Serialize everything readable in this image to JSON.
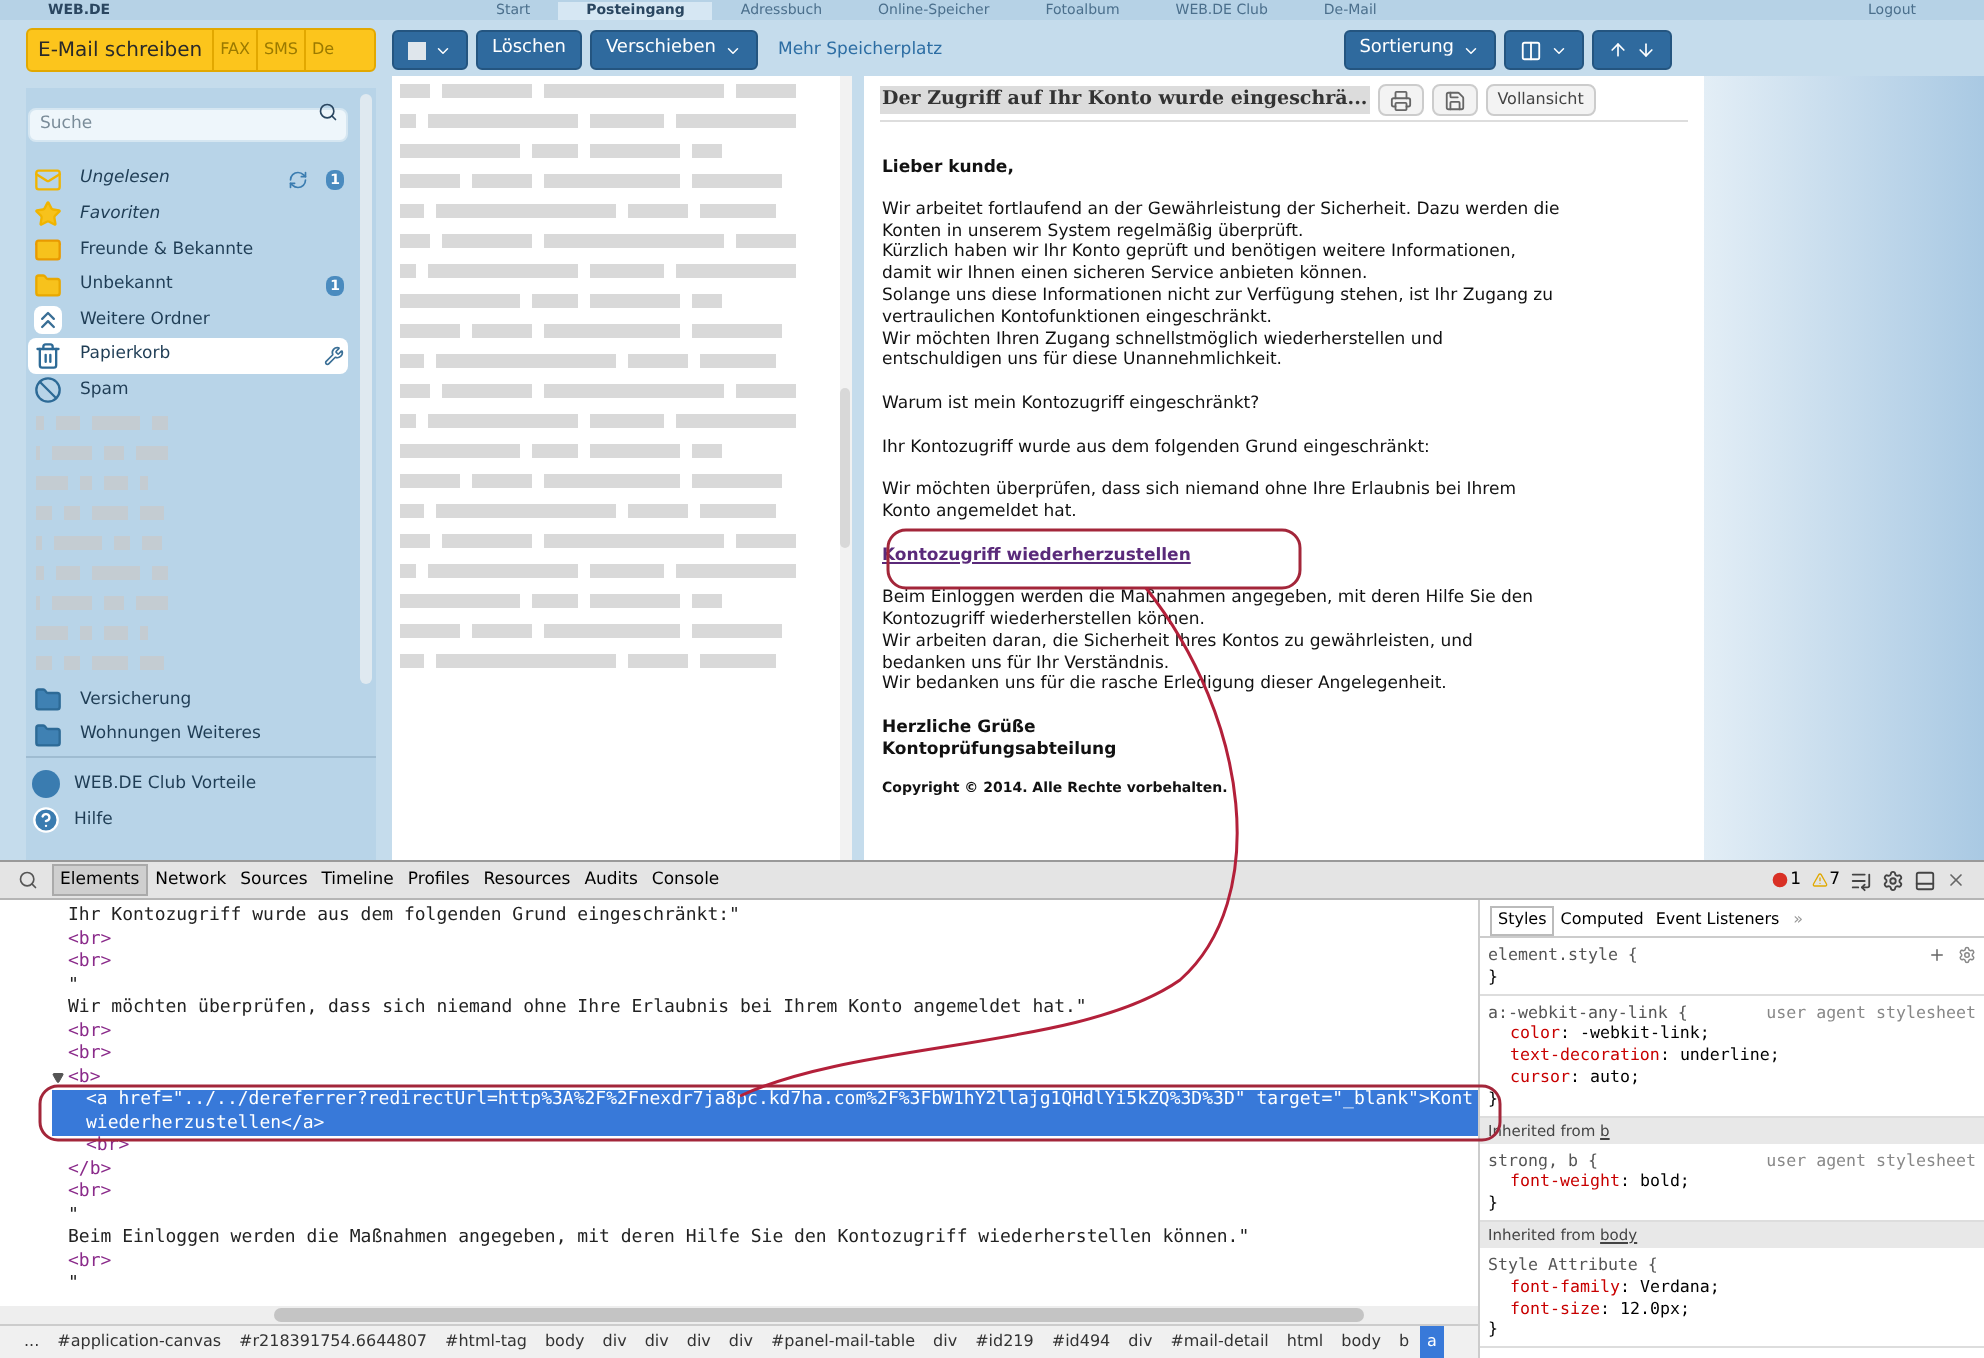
{
  "top_nav": {
    "logo": "WEB.DE",
    "tabs": [
      {
        "label": "Start",
        "selected": false
      },
      {
        "label": "Posteingang",
        "selected": true
      },
      {
        "label": "Adressbuch",
        "selected": false
      },
      {
        "label": "Online-Speicher",
        "selected": false
      },
      {
        "label": "Fotoalbum",
        "selected": false
      },
      {
        "label": "WEB.DE Club",
        "selected": false
      },
      {
        "label": "De-Mail",
        "selected": false
      }
    ],
    "logout": "Logout"
  },
  "compose": {
    "label": "E-Mail schreiben",
    "extras": [
      "FAX",
      "SMS",
      "De"
    ]
  },
  "sidebar": {
    "search": {
      "placeholder": "Suche"
    },
    "folders": [
      {
        "kind": "unread",
        "label": "Ungelesen",
        "italic": true,
        "count": "1",
        "selected": false
      },
      {
        "kind": "favorites",
        "label": "Favoriten",
        "italic": true,
        "selected": false
      },
      {
        "kind": "friends",
        "label": "Freunde & Bekannte",
        "italic": false,
        "selected": false
      },
      {
        "kind": "unknown",
        "label": "Unbekannt",
        "italic": false,
        "count": "1",
        "selected": false
      },
      {
        "kind": "more",
        "label": "Weitere Ordner",
        "italic": false,
        "selected": false
      },
      {
        "kind": "trash",
        "label": "Papierkorb",
        "italic": false,
        "selected": true
      },
      {
        "kind": "spam",
        "label": "Spam",
        "italic": false,
        "selected": false
      }
    ],
    "more_folders": [
      {
        "kind": "folder",
        "label": "Versicherung",
        "italic": false,
        "selected": false
      },
      {
        "kind": "folder",
        "label": "Wohnungen Weiteres",
        "italic": false,
        "selected": false
      }
    ],
    "links": [
      {
        "kind": "club",
        "label": "WEB.DE Club Vorteile"
      },
      {
        "kind": "help",
        "label": "Hilfe"
      }
    ]
  },
  "toolbar": {
    "delete": "Löschen",
    "move": "Verschieben",
    "more_storage": "Mehr Speicherplatz",
    "sort": "Sortierung"
  },
  "mail": {
    "subject": "Der Zugriff auf Ihr Konto wurde eingeschrä...",
    "full_view": "Vollansicht",
    "greeting": "Lieber kunde,",
    "paragraphs": [
      "Wir arbeitet fortlaufend an der Gewährleistung der Sicherheit. Dazu werden die\nKonten in unserem System regelmäßig überprüft.\nKürzlich haben wir Ihr Konto geprüft und benötigen weitere Informationen,\ndamit wir Ihnen einen sicheren Service anbieten können.\nSolange uns diese Informationen nicht zur Verfügung stehen, ist Ihr Zugang zu\nvertraulichen Kontofunktionen eingeschränkt.\nWir möchten Ihren Zugang schnellstmöglich wiederherstellen und\nentschuldigen uns für diese Unannehmlichkeit.",
      "Warum ist mein Kontozugriff eingeschränkt?",
      "Ihr Kontozugriff wurde aus dem folgenden Grund eingeschränkt:",
      "Wir möchten überprüfen, dass sich niemand ohne Ihre Erlaubnis bei Ihrem\nKonto angemeldet hat."
    ],
    "link": "Kontozugriff wiederherzustellen",
    "after": "Beim Einloggen werden die Maßnahmen angegeben, mit deren Hilfe Sie den\nKontozugriff wiederherstellen können.\nWir arbeiten daran, die Sicherheit Ihres Kontos zu gewährleisten, und\nbedanken uns für Ihr Verständnis.\nWir bedanken uns für die rasche Erledigung dieser Angelegenheit.",
    "signature": "Herzliche Grüße\nKontoprüfungsabteilung",
    "copyright": "Copyright © 2014. Alle Rechte vorbehalten."
  },
  "devtools": {
    "tabs": [
      {
        "label": "Elements",
        "selected": true
      },
      {
        "label": "Network",
        "selected": false
      },
      {
        "label": "Sources",
        "selected": false
      },
      {
        "label": "Timeline",
        "selected": false
      },
      {
        "label": "Profiles",
        "selected": false
      },
      {
        "label": "Resources",
        "selected": false
      },
      {
        "label": "Audits",
        "selected": false
      },
      {
        "label": "Console",
        "selected": false
      }
    ],
    "errors": "1",
    "warnings": "7",
    "dom_tree": [
      {
        "text": "Ihr Kontozugriff wurde aus dem folgenden Grund eingeschränkt:\""
      },
      {
        "text": "<br>"
      },
      {
        "text": "<br>"
      },
      {
        "text": "\""
      },
      {
        "text": "Wir möchten überprüfen, dass sich niemand ohne Ihre Erlaubnis bei Ihrem Konto angemeldet hat.\""
      },
      {
        "text": "<br>"
      },
      {
        "text": "<br>"
      },
      {
        "text": "<b>",
        "expanded": true,
        "closing": "</b>",
        "children": [
          {
            "text": "<a href=\"../../dereferrer?redirectUrl=http%3A%2F%2Fnexdr7ja8pc.kd7ha.com%2F%3FbW1hY2llajg1QHdlYi5kZQ%3D%3D\" target=\"_blank\">Kont",
            "continuation": "wiederherzustellen</a>",
            "selected": true
          },
          {
            "text": "<br>",
            "selected": false
          }
        ]
      },
      {
        "text": "<br>"
      },
      {
        "text": "\""
      },
      {
        "text": "Beim Einloggen werden die Maßnahmen angegeben, mit deren Hilfe Sie den Kontozugriff wiederherstellen können.\""
      },
      {
        "text": "<br>"
      },
      {
        "text": "\""
      }
    ],
    "breadcrumbs": [
      {
        "label": "...",
        "selected": false
      },
      {
        "label": "#application-canvas",
        "selected": false
      },
      {
        "label": "#r218391754.6644807",
        "selected": false
      },
      {
        "label": "#html-tag",
        "selected": false
      },
      {
        "label": "body",
        "selected": false
      },
      {
        "label": "div",
        "selected": false
      },
      {
        "label": "div",
        "selected": false
      },
      {
        "label": "div",
        "selected": false
      },
      {
        "label": "div",
        "selected": false
      },
      {
        "label": "#panel-mail-table",
        "selected": false
      },
      {
        "label": "div",
        "selected": false
      },
      {
        "label": "#id219",
        "selected": false
      },
      {
        "label": "#id494",
        "selected": false
      },
      {
        "label": "div",
        "selected": false
      },
      {
        "label": "#mail-detail",
        "selected": false
      },
      {
        "label": "html",
        "selected": false
      },
      {
        "label": "body",
        "selected": false
      },
      {
        "label": "b",
        "selected": false
      },
      {
        "label": "a",
        "selected": true
      }
    ],
    "styles": {
      "tabs": [
        {
          "label": "Styles",
          "selected": true
        },
        {
          "label": "Computed",
          "selected": false
        },
        {
          "label": "Event Listeners",
          "selected": false
        }
      ],
      "more": "»",
      "sections": [
        {
          "rules": [
            {
              "selector": "element.style {",
              "close": "}"
            }
          ]
        },
        {
          "rules": [
            {
              "selector": "a:-webkit-any-link {",
              "source": "user agent stylesheet",
              "declarations": [
                {
                  "property": "color",
                  "sep": ":",
                  "value": "-webkit-link;"
                },
                {
                  "property": "text-decoration",
                  "sep": ":",
                  "value": "underline;"
                },
                {
                  "property": "cursor",
                  "sep": ":",
                  "value": "auto;"
                }
              ],
              "close": "}"
            }
          ]
        },
        {
          "inherited": "Inherited from",
          "from": "b",
          "rules": [
            {
              "selector": "strong, b {",
              "source": "user agent stylesheet",
              "declarations": [
                {
                  "property": "font-weight",
                  "sep": ":",
                  "value": "bold;"
                }
              ],
              "close": "}"
            }
          ]
        },
        {
          "inherited": "Inherited from",
          "from": "body",
          "rules": [
            {
              "selector": "Style Attribute {",
              "declarations": [
                {
                  "property": "font-family",
                  "sep": ":",
                  "value": "Verdana;"
                },
                {
                  "property": "font-size",
                  "sep": ":",
                  "value": "12.0px;"
                }
              ],
              "close": "}"
            }
          ]
        }
      ]
    }
  }
}
